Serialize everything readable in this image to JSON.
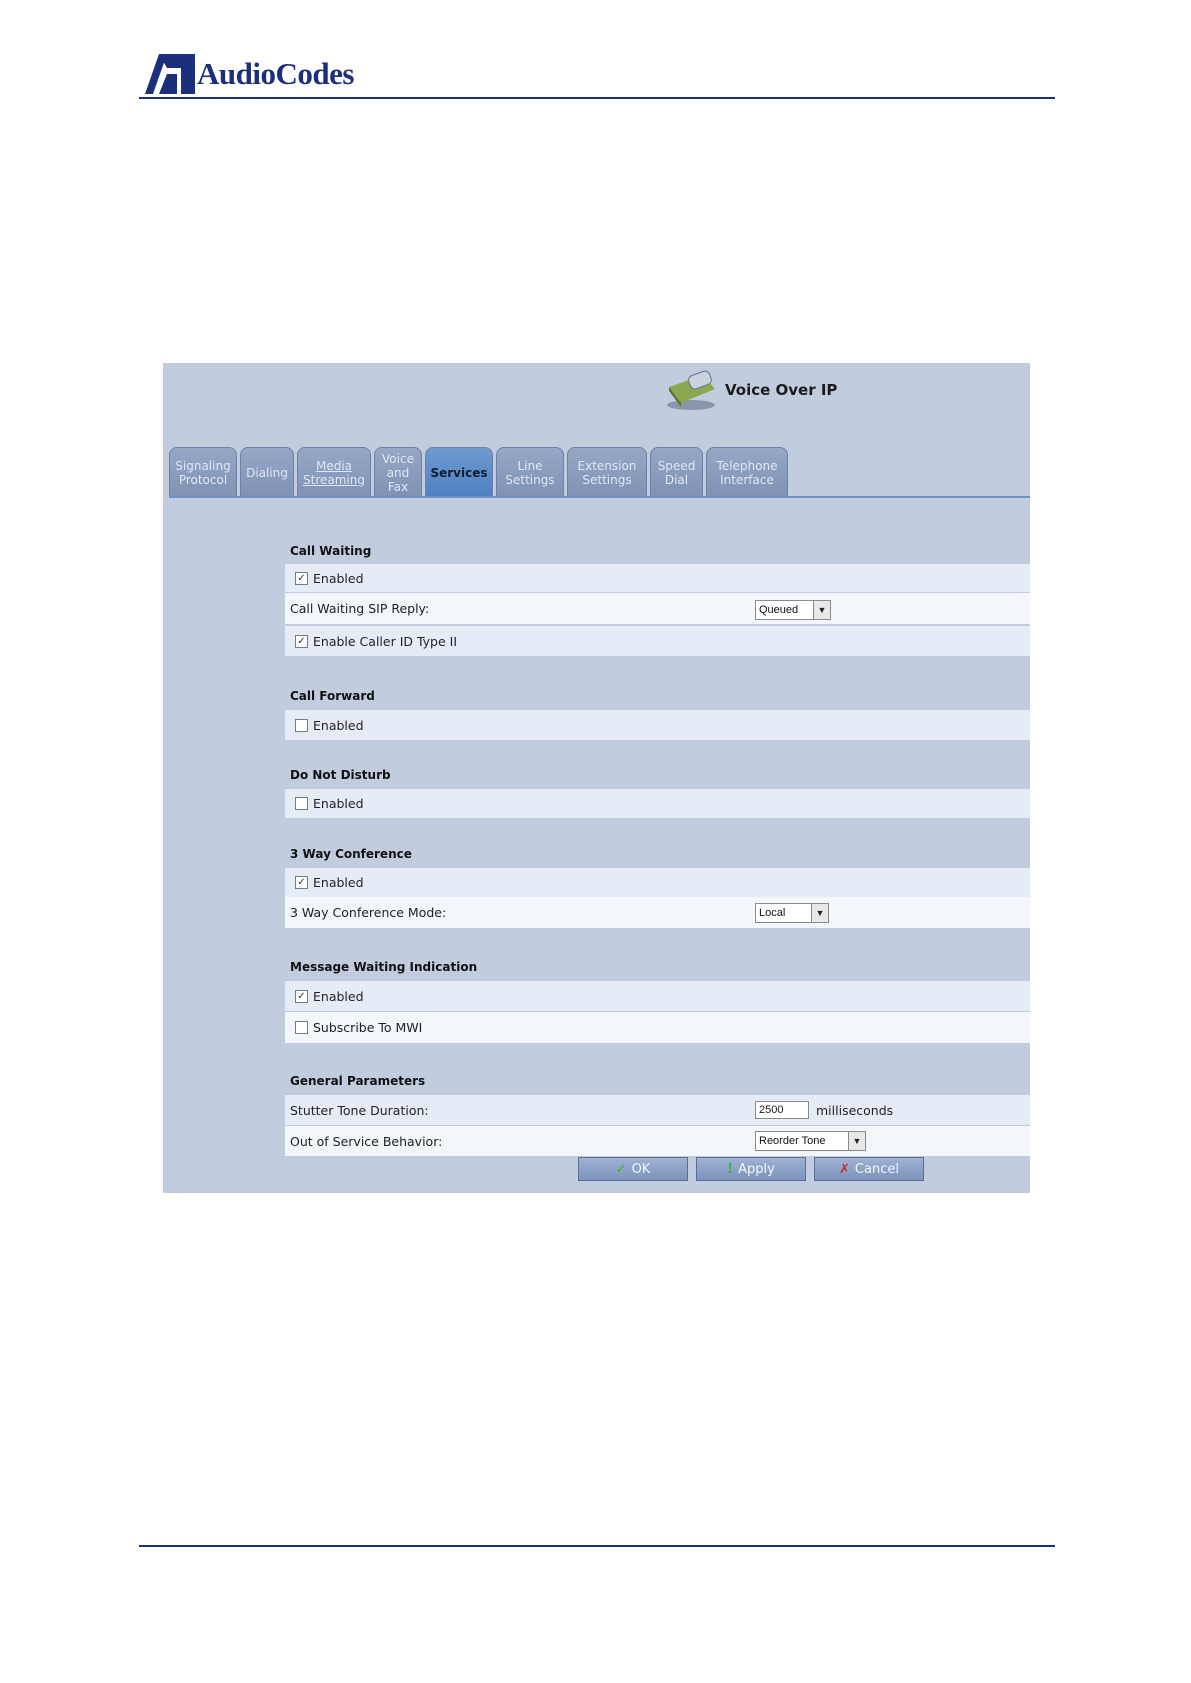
{
  "document": {
    "brand": "AudioCodes"
  },
  "window": {
    "title": "Voice Over IP"
  },
  "tabs": [
    {
      "label": "Signaling\nProtocol",
      "active": false
    },
    {
      "label": "Dialing",
      "active": false
    },
    {
      "label": "Media\nStreaming",
      "active": false
    },
    {
      "label": "Voice\nand\nFax",
      "active": false
    },
    {
      "label": "Services",
      "active": true
    },
    {
      "label": "Line\nSettings",
      "active": false
    },
    {
      "label": "Extension\nSettings",
      "active": false
    },
    {
      "label": "Speed\nDial",
      "active": false
    },
    {
      "label": "Telephone\nInterface",
      "active": false
    }
  ],
  "sections": {
    "call_waiting": {
      "title": "Call Waiting",
      "enabled_label": "Enabled",
      "enabled": true,
      "sip_reply_label": "Call Waiting SIP Reply:",
      "sip_reply_value": "Queued",
      "caller_id_label": "Enable Caller ID Type II",
      "caller_id": true
    },
    "call_forward": {
      "title": "Call Forward",
      "enabled_label": "Enabled",
      "enabled": false
    },
    "do_not_disturb": {
      "title": "Do Not Disturb",
      "enabled_label": "Enabled",
      "enabled": false
    },
    "three_way": {
      "title": "3 Way Conference",
      "enabled_label": "Enabled",
      "enabled": true,
      "mode_label": "3 Way Conference Mode:",
      "mode_value": "Local"
    },
    "mwi": {
      "title": "Message Waiting Indication",
      "enabled_label": "Enabled",
      "enabled": true,
      "subscribe_label": "Subscribe To MWI",
      "subscribe": false
    },
    "general": {
      "title": "General Parameters",
      "stutter_label": "Stutter Tone Duration:",
      "stutter_value": "2500",
      "stutter_unit": "milliseconds",
      "oos_label": "Out of Service Behavior:",
      "oos_value": "Reorder Tone"
    }
  },
  "buttons": {
    "ok": "OK",
    "apply": "Apply",
    "cancel": "Cancel"
  },
  "colors": {
    "brand_blue": "#1b2f7a",
    "panel": "#c2ccdf",
    "active_tab": "#4f7fc0"
  }
}
